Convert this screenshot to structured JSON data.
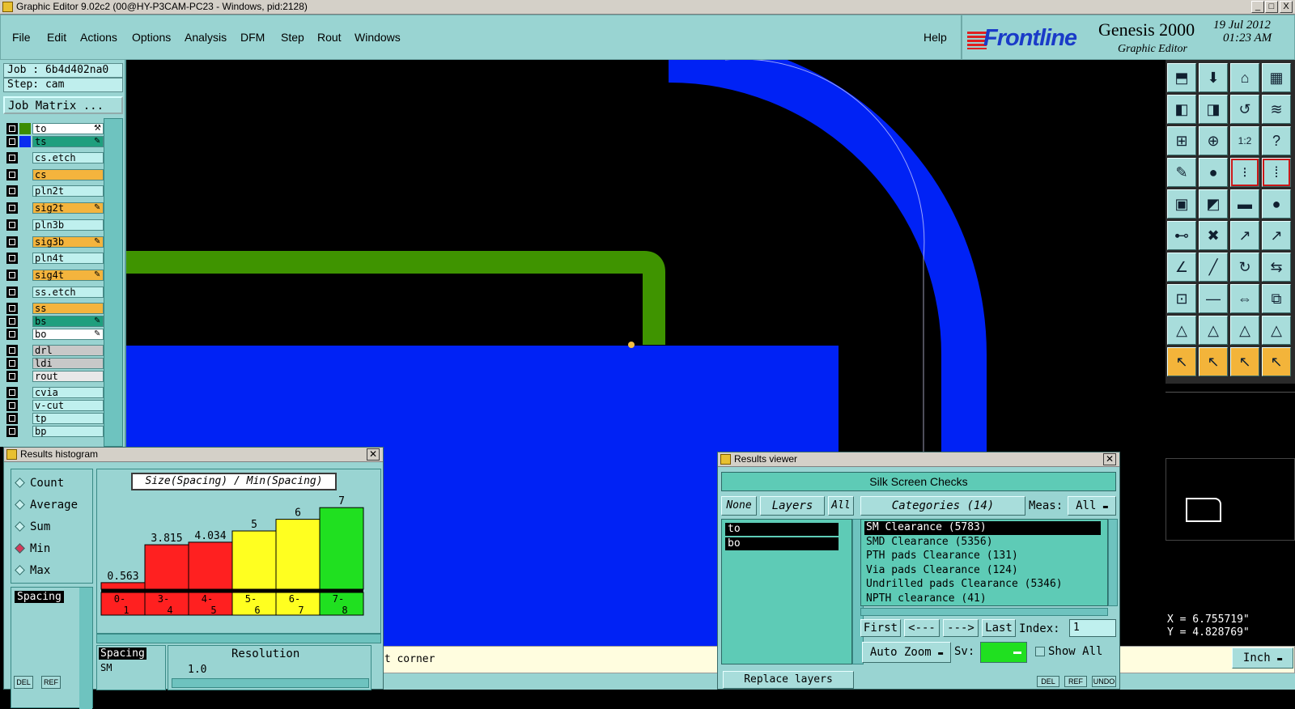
{
  "window": {
    "title": "Graphic Editor 9.02c2 (00@HY-P3CAM-PC23 - Windows, pid:2128)",
    "buttons": [
      "_",
      "□",
      "X"
    ]
  },
  "menu": {
    "items": [
      "File",
      "Edit",
      "Actions",
      "Options",
      "Analysis",
      "DFM",
      "Step",
      "Rout",
      "Windows"
    ],
    "help": "Help"
  },
  "brand": {
    "logo": "Frontline",
    "product": "Genesis 2000",
    "subtitle": "Graphic Editor",
    "date": "19 Jul 2012",
    "time": "01:23 AM"
  },
  "left_panel": {
    "job": "Job : 6b4d402na0",
    "step": "Step: cam",
    "matrix_button": "Job Matrix ...",
    "layers": [
      {
        "name": "to",
        "color": "#ffffff",
        "swatch": "#3c8c00",
        "flag": "⚒"
      },
      {
        "name": "ts",
        "color": "#1f9f7e",
        "swatch": "#0a2cf0",
        "flag": "✎"
      },
      {
        "name": "cs.etch",
        "color": "#bff0ee",
        "swatch": "",
        "flag": ""
      },
      {
        "name": "cs",
        "color": "#f4b43d",
        "swatch": "",
        "flag": ""
      },
      {
        "name": "pln2t",
        "color": "#bff0ee",
        "swatch": "",
        "flag": ""
      },
      {
        "name": "sig2t",
        "color": "#f4b43d",
        "swatch": "",
        "flag": "✎"
      },
      {
        "name": "pln3b",
        "color": "#bff0ee",
        "swatch": "",
        "flag": ""
      },
      {
        "name": "sig3b",
        "color": "#f4b43d",
        "swatch": "",
        "flag": "✎"
      },
      {
        "name": "pln4t",
        "color": "#bff0ee",
        "swatch": "",
        "flag": ""
      },
      {
        "name": "sig4t",
        "color": "#f4b43d",
        "swatch": "",
        "flag": "✎"
      },
      {
        "name": "ss.etch",
        "color": "#bff0ee",
        "swatch": "",
        "flag": ""
      },
      {
        "name": "ss",
        "color": "#f4b43d",
        "swatch": "",
        "flag": ""
      },
      {
        "name": "bs",
        "color": "#1f9f7e",
        "swatch": "",
        "flag": "✎"
      },
      {
        "name": "bo",
        "color": "#ffffff",
        "swatch": "",
        "flag": "✎"
      },
      {
        "name": "drl",
        "color": "#c8c8c8",
        "swatch": "",
        "flag": ""
      },
      {
        "name": "ldi",
        "color": "#c8c8c8",
        "swatch": "",
        "flag": ""
      },
      {
        "name": "rout",
        "color": "#e8e8e8",
        "swatch": "",
        "flag": ""
      },
      {
        "name": "cvia",
        "color": "#bff0ee",
        "swatch": "",
        "flag": ""
      },
      {
        "name": "v-cut",
        "color": "#bff0ee",
        "swatch": "",
        "flag": ""
      },
      {
        "name": "tp",
        "color": "#bff0ee",
        "swatch": "",
        "flag": ""
      },
      {
        "name": "bp",
        "color": "#bff0ee",
        "swatch": "",
        "flag": ""
      }
    ]
  },
  "canvas": {
    "colors": {
      "background": "#000000",
      "green": "#3f9400",
      "blue": "#0022f5"
    }
  },
  "coords": {
    "x": "X = 6.755719\"",
    "y": "Y = 4.828769\""
  },
  "status": {
    "message": "st corner",
    "units": "Inch"
  },
  "histogram": {
    "title": "Results histogram",
    "modes": [
      "Count",
      "Average",
      "Sum",
      "Min",
      "Max"
    ],
    "selected_mode": "Min",
    "measure": "Spacing",
    "header": "Size(Spacing) / Min(Spacing)",
    "resolution_label": "Resolution",
    "resolution_value": "1.0",
    "list": [
      "Spacing",
      "SM"
    ],
    "buttons": [
      "DEL",
      "REF"
    ]
  },
  "chart_data": {
    "type": "bar",
    "title": "Size(Spacing) / Min(Spacing)",
    "categories": [
      "0-1",
      "3-4",
      "4-5",
      "5-6",
      "6-7",
      "7-8"
    ],
    "values": [
      0.563,
      3.815,
      4.034,
      5,
      6,
      7
    ],
    "value_labels": [
      "0.563",
      "3.815",
      "4.034",
      "5",
      "6",
      "7"
    ],
    "colors": [
      "#ff2020",
      "#ff2020",
      "#ff2020",
      "#ffff20",
      "#ffff20",
      "#20e020"
    ],
    "ylim": [
      0,
      7.5
    ]
  },
  "viewer": {
    "title": "Results viewer",
    "header": "Silk Screen Checks",
    "none": "None",
    "layers_label": "Layers",
    "all": "All",
    "categories_label": "Categories (14)",
    "meas_label": "Meas:",
    "meas_value": "All",
    "layers": [
      "to",
      "bo"
    ],
    "categories": [
      "SM Clearance (5783)",
      "SMD Clearance (5356)",
      "PTH pads Clearance (131)",
      "Via pads Clearance (124)",
      "Undrilled pads Clearance (5346)",
      "NPTH clearance (41)"
    ],
    "nav": [
      "First",
      "<---",
      "--->",
      "Last"
    ],
    "index_label": "Index:",
    "index_value": "1",
    "auto_zoom": "Auto Zoom",
    "sv_label": "Sv:",
    "show_all": "Show All",
    "replace": "Replace layers",
    "bottom_buttons": [
      "DEL",
      "REF",
      "UNDO"
    ]
  }
}
